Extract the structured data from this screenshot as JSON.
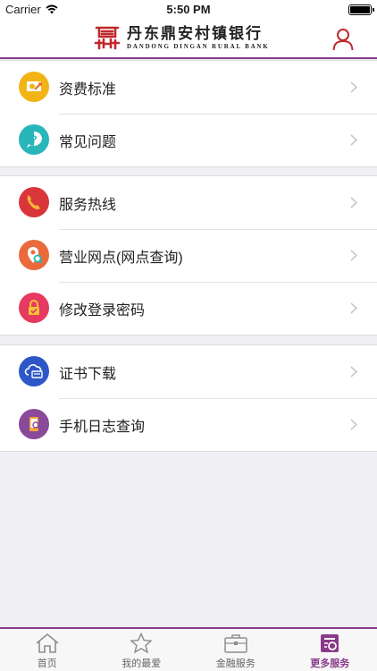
{
  "status_bar": {
    "carrier": "Carrier",
    "time": "5:50 PM"
  },
  "header": {
    "logo_cn": "丹东鼎安村镇银行",
    "logo_en": "DANDONG DINGAN RURAL BANK",
    "logo_icon": "bank-logo-icon",
    "user_icon": "user-icon"
  },
  "menu_groups": [
    {
      "items": [
        {
          "label": "资费标准",
          "icon": "fee-icon",
          "color": "#f2b315"
        },
        {
          "label": "常见问题",
          "icon": "question-icon",
          "color": "#29b6b9"
        }
      ]
    },
    {
      "items": [
        {
          "label": "服务热线",
          "icon": "phone-icon",
          "color": "#d9363b"
        },
        {
          "label": "营业网点(网点查询)",
          "icon": "location-icon",
          "color": "#ea6a3c"
        },
        {
          "label": "修改登录密码",
          "icon": "lock-icon",
          "color": "#e63a61"
        }
      ]
    },
    {
      "items": [
        {
          "label": "证书下载",
          "icon": "cloud-certificate-icon",
          "color": "#2d57c8"
        },
        {
          "label": "手机日志查询",
          "icon": "mobile-log-icon",
          "color": "#8a4a9a"
        }
      ]
    }
  ],
  "tabs": [
    {
      "label": "首页",
      "icon": "home-icon",
      "active": false
    },
    {
      "label": "我的最爱",
      "icon": "star-icon",
      "active": false
    },
    {
      "label": "金融服务",
      "icon": "briefcase-icon",
      "active": false
    },
    {
      "label": "更多服务",
      "icon": "more-services-icon",
      "active": true
    }
  ],
  "colors": {
    "accent": "#8a3a8a",
    "chevron": "#c7c7cc"
  }
}
